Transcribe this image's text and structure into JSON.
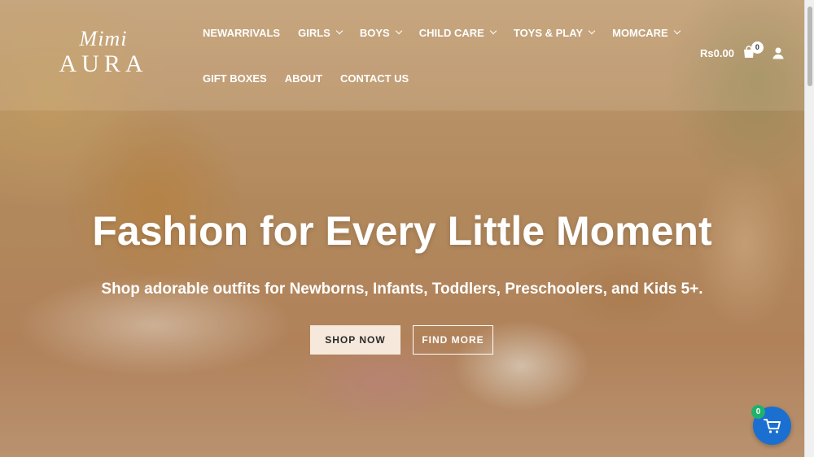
{
  "brand": {
    "logo_top": "Mimi",
    "logo_bottom": "AURA"
  },
  "nav": {
    "row1": [
      {
        "label": "NEWARRIVALS",
        "has_dropdown": false
      },
      {
        "label": "GIRLS",
        "has_dropdown": true
      },
      {
        "label": "BOYS",
        "has_dropdown": true
      },
      {
        "label": "CHILD CARE",
        "has_dropdown": true
      },
      {
        "label": "TOYS & PLAY",
        "has_dropdown": true
      },
      {
        "label": "MOMCARE",
        "has_dropdown": true
      }
    ],
    "row2": [
      {
        "label": "GIFT BOXES"
      },
      {
        "label": "ABOUT"
      },
      {
        "label": "CONTACT US"
      }
    ]
  },
  "cart": {
    "total": "Rs0.00",
    "count": "0",
    "icon": "shopping-bag-icon"
  },
  "account": {
    "icon": "user-icon"
  },
  "hero": {
    "title": "Fashion for Every Little Moment",
    "subtitle": "Shop adorable outfits for Newborns, Infants, Toddlers, Preschoolers, and Kids 5+.",
    "primary_button": "SHOP NOW",
    "secondary_button": "FIND MORE"
  },
  "floating_cart": {
    "count": "0",
    "icon": "cart-icon"
  },
  "colors": {
    "accent_blue": "#1b6fd1",
    "badge_green": "#1fb26b",
    "button_cream": "#f6e9dc"
  }
}
